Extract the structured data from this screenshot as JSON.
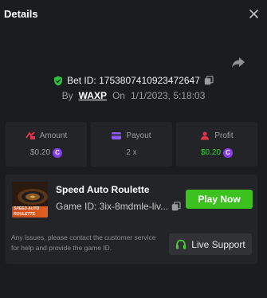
{
  "header": {
    "title": "Details"
  },
  "bet": {
    "label": "Bet ID: 1753807410923472647"
  },
  "by": {
    "prefix": "By",
    "user": "WAXP",
    "prefix_on": "On",
    "datetime": "1/1/2023, 5:18:03"
  },
  "stats": [
    {
      "label": "Amount",
      "value": "$0.20"
    },
    {
      "label": "Payout",
      "value": "2 x"
    },
    {
      "label": "Profit",
      "value": "$0.20"
    }
  ],
  "game": {
    "thumb_text": "SPEED AUTO ROULETTE",
    "title": "Speed Auto Roulette",
    "id_label": "Game ID: 3ix-8mdmle-liv...",
    "play_label": "Play Now",
    "help_text": "Any issues, please contact the customer service for help and provide the game ID.",
    "support_label": "Live Support"
  },
  "colors": {
    "accent_green": "#3cc21e",
    "profit_green": "#3cd13c",
    "coin_purple": "#8a3cf0",
    "amount_red": "#e0344a",
    "payout_purple": "#8a5cf0",
    "profit_red": "#e0344a"
  }
}
